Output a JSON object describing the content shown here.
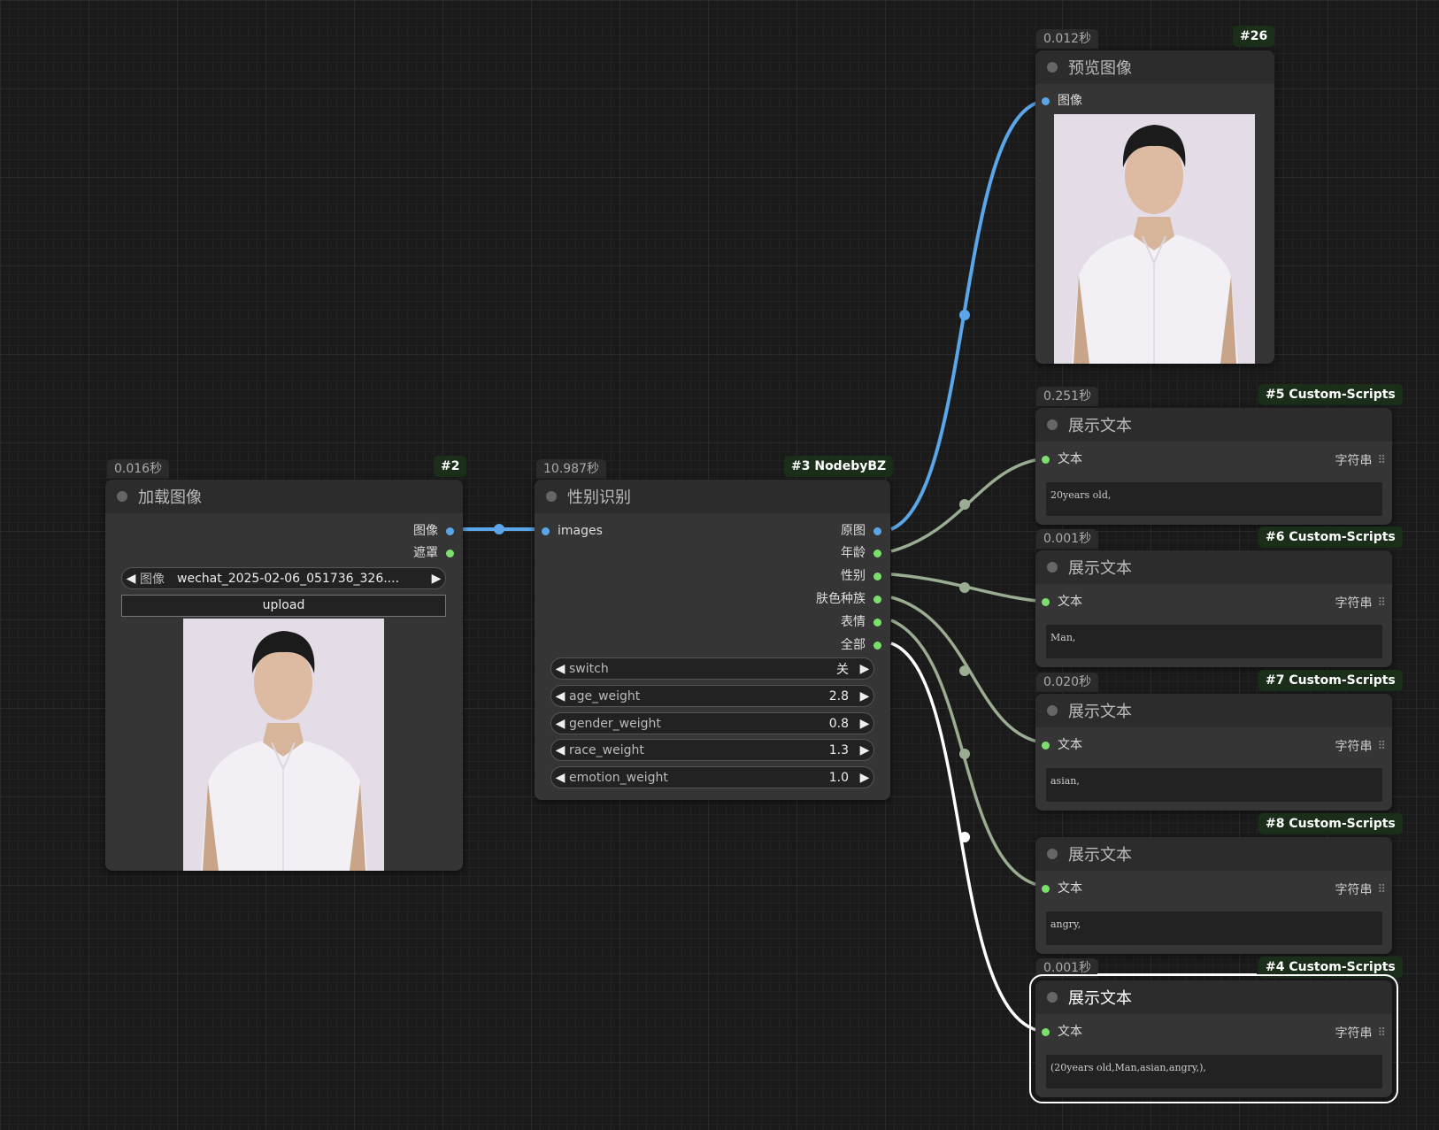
{
  "colors": {
    "image_link": "#5aa6e8",
    "text_link": "#9aad92",
    "selected_link": "#ffffff",
    "badge_bg": "#1a2e1a"
  },
  "load_node": {
    "timing": "0.016秒",
    "badge": "#2",
    "title": "加载图像",
    "outputs": [
      "图像",
      "遮罩"
    ],
    "image_widget_label": "图像",
    "image_widget_value": "wechat_2025-02-06_051736_326....",
    "upload_label": "upload"
  },
  "gender_node": {
    "timing": "10.987秒",
    "badge": "#3 NodebyBZ",
    "title": "性别识别",
    "input": "images",
    "outputs": [
      "原图",
      "年龄",
      "性别",
      "肤色种族",
      "表情",
      "全部"
    ],
    "widgets": [
      {
        "label": "switch",
        "value": "关"
      },
      {
        "label": "age_weight",
        "value": "2.8"
      },
      {
        "label": "gender_weight",
        "value": "0.8"
      },
      {
        "label": "race_weight",
        "value": "1.3"
      },
      {
        "label": "emotion_weight",
        "value": "1.0"
      }
    ]
  },
  "preview_node": {
    "timing": "0.012秒",
    "badge": "#26",
    "title": "预览图像",
    "input": "图像"
  },
  "text_nodes": [
    {
      "timing": "0.251秒",
      "badge": "#5 Custom-Scripts",
      "title": "展示文本",
      "input": "文本",
      "type": "字符串",
      "text": "20years old,"
    },
    {
      "timing": "0.001秒",
      "badge": "#6 Custom-Scripts",
      "title": "展示文本",
      "input": "文本",
      "type": "字符串",
      "text": "Man,"
    },
    {
      "timing": "0.020秒",
      "badge": "#7 Custom-Scripts",
      "title": "展示文本",
      "input": "文本",
      "type": "字符串",
      "text": "asian,"
    },
    {
      "timing": "",
      "badge": "#8 Custom-Scripts",
      "title": "展示文本",
      "input": "文本",
      "type": "字符串",
      "text": "angry,"
    },
    {
      "timing": "0.001秒",
      "badge": "#4 Custom-Scripts",
      "title": "展示文本",
      "input": "文本",
      "type": "字符串",
      "text": "(20years old,Man,asian,angry,),"
    }
  ]
}
